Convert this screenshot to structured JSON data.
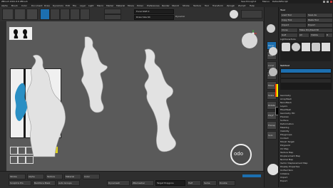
{
  "app": {
    "title_segments": [
      "ZBrush 2021.6.6",
      "ZBrush"
    ],
    "see_through_label": "See-through 0",
    "menus_label": "Menus",
    "default_script_label": "DefaultZScript"
  },
  "menubar": {
    "items": [
      "Alpha",
      "Brush",
      "Color",
      "Document",
      "Draw",
      "Dynamics",
      "Edit",
      "File",
      "Layer",
      "Light",
      "Macro",
      "Marker",
      "Material",
      "Movie",
      "Picker",
      "Preferences",
      "Render",
      "Stencil",
      "Stroke",
      "Texture",
      "Tool",
      "Transform",
      "Zplugin",
      "Zscript",
      "Help"
    ]
  },
  "toolbar": {
    "focal_shift_label": "Focal Shift 0",
    "draw_size_label": "Draw Size 64",
    "dynamic_label": "Dynamic"
  },
  "viewport": {
    "logo_text": "odo"
  },
  "tool_palette": {
    "title": "Tool",
    "buttons": [
      "Load Tool",
      "Save As",
      "Copy Tool",
      "Paste Tool",
      "Import",
      "Export",
      "Clone",
      "Make PolyMesh3D",
      "GoZ",
      "All",
      "Visible",
      "R"
    ],
    "lightbox_label": "Lightbox▸Tools",
    "subtool_label": "Subtool",
    "sections": [
      "Geometry",
      "ArrayMesh",
      "NanoMesh",
      "Layers",
      "FiberMesh",
      "Geometry HD",
      "Preview",
      "Surface",
      "Deformation",
      "Masking",
      "Visibility",
      "Polygroups",
      "Contact",
      "Morph Target",
      "Polypaint",
      "UV Map",
      "Texture Map",
      "Displacement Map",
      "Normal Map",
      "Vector Displacement Map",
      "Display Properties",
      "Unified Skin",
      "Initialize",
      "Import",
      "Export"
    ]
  },
  "shelf": {
    "items": [
      "Persp",
      "Floor",
      "Local",
      "Frame",
      "Move",
      "Scale",
      "Rotate",
      "PolyF",
      "Transp",
      "Solo"
    ]
  },
  "bottom": {
    "row1": [
      "Stroke",
      "Alpha",
      "Texture",
      "Material",
      "Color"
    ],
    "row2": [
      "Sculptris Pro",
      "Backface Mask",
      "Auto Groups",
      "Dynamesh",
      "ZRemesher",
      "Target Polygons",
      "Half",
      "Same",
      "Double"
    ]
  },
  "colors": {
    "accent": "#1c6fb0",
    "swatch_main": "#000000",
    "swatch_secondary": "#ffffff",
    "viewport_bg": "#5a5a5a",
    "figure_highlight": "#2a8fc4"
  }
}
